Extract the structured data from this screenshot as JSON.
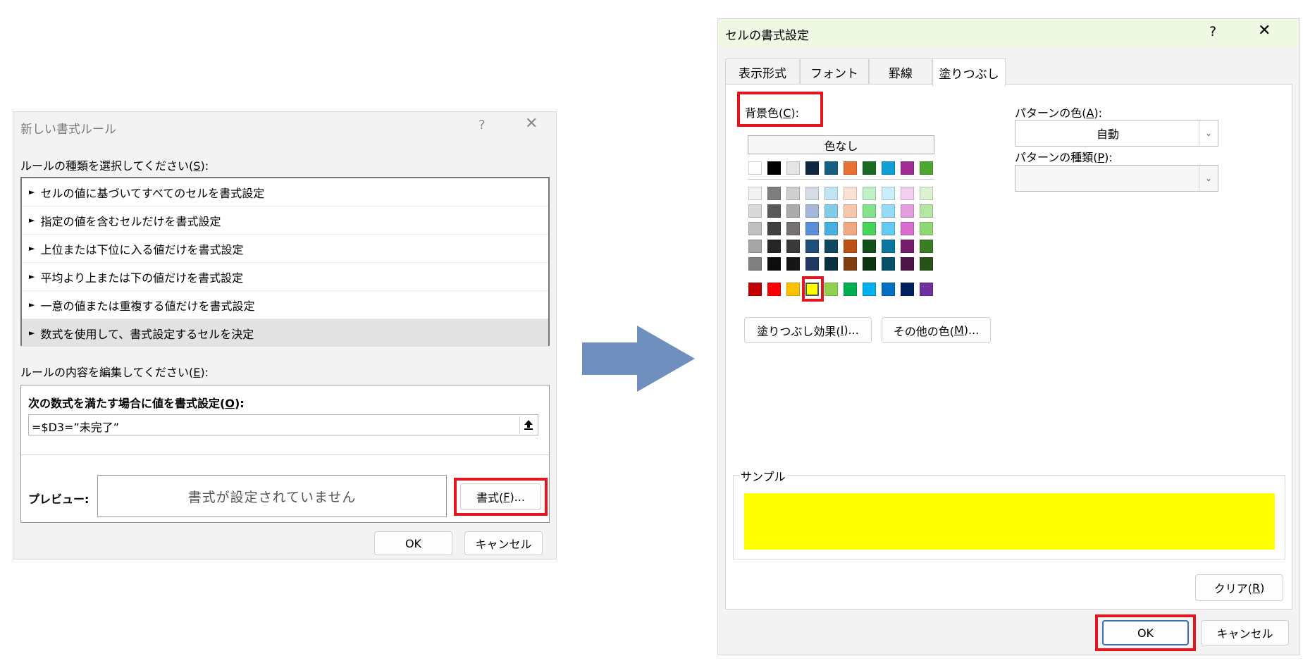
{
  "dialog1": {
    "title": "新しい書式ルール",
    "help": "?",
    "close": "✕",
    "rule_type_label_a": "ルールの種類を選択してください(",
    "rule_type_label_key": "S",
    "rule_type_label_b": "):",
    "rule_types": [
      "セルの値に基づいてすべてのセルを書式設定",
      "指定の値を含むセルだけを書式設定",
      "上位または下位に入る値だけを書式設定",
      "平均より上または下の値だけを書式設定",
      "一意の値または重複する値だけを書式設定",
      "数式を使用して、書式設定するセルを決定"
    ],
    "rule_edit_label_a": "ルールの内容を編集してください(",
    "rule_edit_label_key": "E",
    "rule_edit_label_b": "):",
    "formula_label_a": "次の数式を満たす場合に値を書式設定(",
    "formula_label_key": "O",
    "formula_label_b": "):",
    "formula_value": "=$D3=”未完了”",
    "preview_label": "プレビュー:",
    "preview_text": "書式が設定されていません",
    "format_button_a": "書式(",
    "format_button_key": "F",
    "format_button_b": ")...",
    "ok_button": "OK",
    "cancel_button": "キャンセル"
  },
  "arrow": {
    "color": "#6f8fbf"
  },
  "dialog2": {
    "title": "セルの書式設定",
    "help": "?",
    "close": "✕",
    "tabs": [
      "表示形式",
      "フォント",
      "罫線",
      "塗りつぶし"
    ],
    "active_tab": "塗りつぶし",
    "bg_color_label_a": "背景色(",
    "bg_color_label_key": "C",
    "bg_color_label_b": "):",
    "no_color_button": "色なし",
    "theme_row": [
      "#ffffff",
      "#000000",
      "#e7e6e6",
      "#0e2841",
      "#156082",
      "#e97132",
      "#196b24",
      "#0f9ed5",
      "#a02b93",
      "#4ea72e"
    ],
    "tint_rows": [
      [
        "#f2f2f2",
        "#7f7f7f",
        "#d0cece",
        "#d6dce5",
        "#c1e4f5",
        "#fbe2d5",
        "#c1f0c8",
        "#caeefb",
        "#f2cfee",
        "#daf2d0"
      ],
      [
        "#d9d9d9",
        "#595959",
        "#aeabab",
        "#a5b8d9",
        "#83cbeb",
        "#f7c7ac",
        "#83e28e",
        "#95dcf7",
        "#e59edd",
        "#b5e6a2"
      ],
      [
        "#bfbfbf",
        "#404040",
        "#767171",
        "#5b8fd9",
        "#45b0e1",
        "#f1a983",
        "#47d359",
        "#61cbf3",
        "#d86dcd",
        "#8ed973"
      ],
      [
        "#a6a6a6",
        "#262626",
        "#3a3838",
        "#1f4e79",
        "#0f4761",
        "#c04f15",
        "#124f1a",
        "#0b76a0",
        "#751e6e",
        "#3b7d23"
      ],
      [
        "#808080",
        "#0d0d0d",
        "#171616",
        "#1f3864",
        "#0a2f41",
        "#7f3f0e",
        "#0c3511",
        "#074f69",
        "#4d1447",
        "#275317"
      ]
    ],
    "standard_row": [
      "#c00000",
      "#ff0000",
      "#ffc000",
      "#ffff00",
      "#92d050",
      "#00b050",
      "#00b0f0",
      "#0070c0",
      "#002060",
      "#7030a0"
    ],
    "selected_color": "#ffff00",
    "fill_effects_button_a": "塗りつぶし効果(",
    "fill_effects_button_key": "I",
    "fill_effects_button_b": ")...",
    "more_colors_button_a": "その他の色(",
    "more_colors_button_key": "M",
    "more_colors_button_b": ")...",
    "pattern_color_label_a": "パターンの色(",
    "pattern_color_label_key": "A",
    "pattern_color_label_b": "):",
    "pattern_color_value": "自動",
    "pattern_style_label_a": "パターンの種類(",
    "pattern_style_label_key": "P",
    "pattern_style_label_b": "):",
    "pattern_style_value": "",
    "sample_label": "サンプル",
    "sample_color": "#ffff00",
    "clear_button_a": "クリア(",
    "clear_button_key": "R",
    "clear_button_b": ")",
    "ok_button": "OK",
    "cancel_button": "キャンセル"
  }
}
